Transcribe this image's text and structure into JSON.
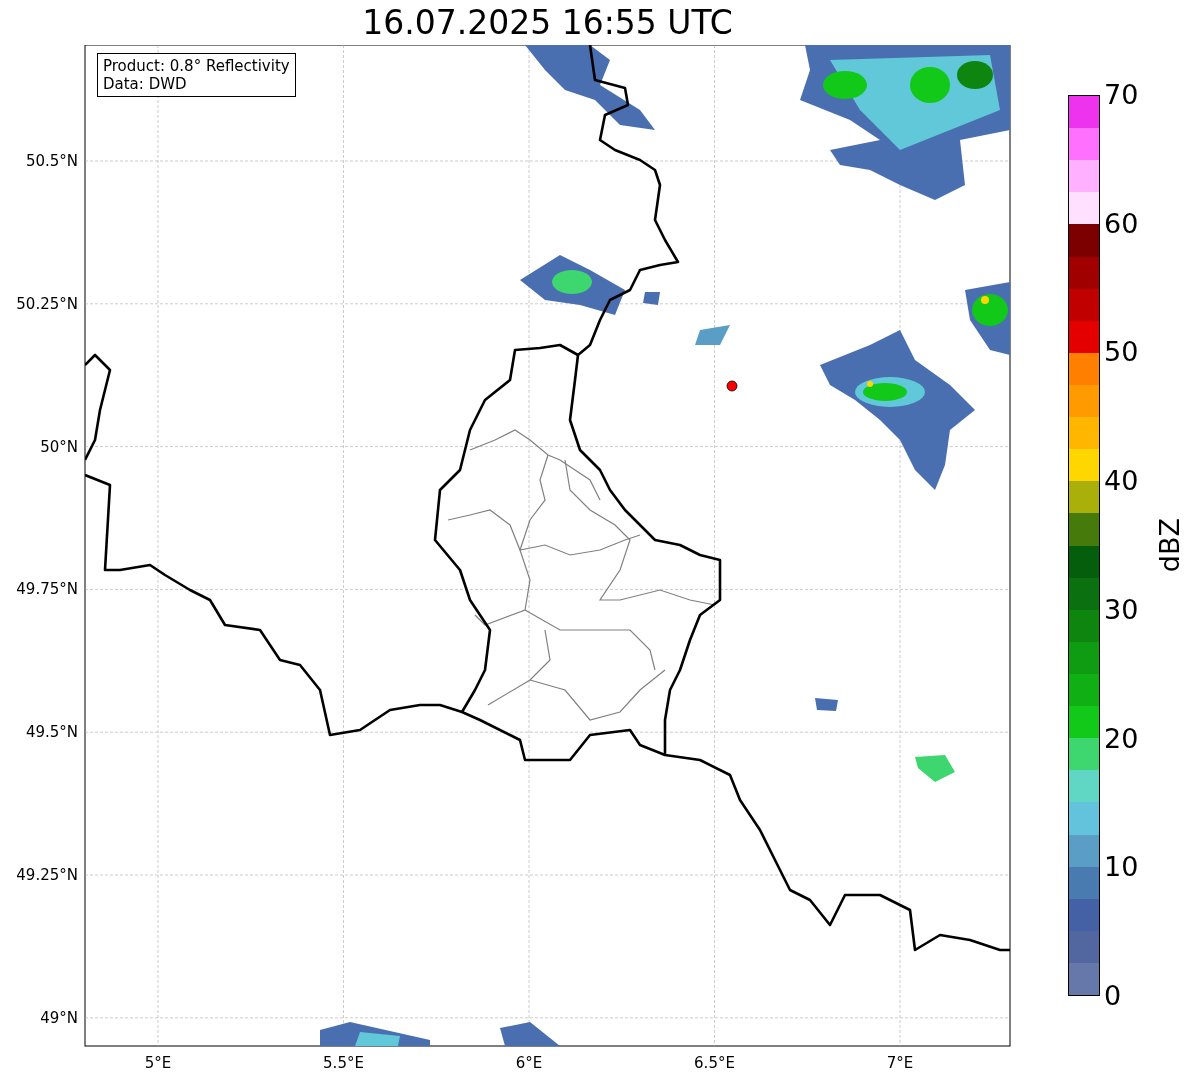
{
  "title": "16.07.2025 16:55 UTC",
  "info_box": {
    "lines": [
      "Product: 0.8° Reflectivity",
      "Data: DWD"
    ]
  },
  "map": {
    "lat_ticks": [
      "50.5°N",
      "50.25°N",
      "50°N",
      "49.75°N",
      "49.5°N",
      "49.25°N",
      "49°N"
    ],
    "lon_ticks": [
      "5°E",
      "5.5°E",
      "6°E",
      "6.5°E",
      "7°E"
    ]
  },
  "colorbar": {
    "label": "dBZ",
    "ticks": [
      "70",
      "60",
      "50",
      "40",
      "30",
      "20",
      "10",
      "0"
    ],
    "bands": [
      {
        "color": "#ee33ee"
      },
      {
        "color": "#ff70ff"
      },
      {
        "color": "#ffb0ff"
      },
      {
        "color": "#ffe0ff"
      },
      {
        "color": "#7d0000"
      },
      {
        "color": "#a00000"
      },
      {
        "color": "#c00000"
      },
      {
        "color": "#e50000"
      },
      {
        "color": "#ff8000"
      },
      {
        "color": "#ff9a00"
      },
      {
        "color": "#ffb600"
      },
      {
        "color": "#ffd700"
      },
      {
        "color": "#aab00a"
      },
      {
        "color": "#467a0a"
      },
      {
        "color": "#055e0b"
      },
      {
        "color": "#0a7010"
      },
      {
        "color": "#0d850f"
      },
      {
        "color": "#0f9b12"
      },
      {
        "color": "#10b014"
      },
      {
        "color": "#12c818"
      },
      {
        "color": "#3dd66f"
      },
      {
        "color": "#60d6c4"
      },
      {
        "color": "#63c3dc"
      },
      {
        "color": "#5a9ec6"
      },
      {
        "color": "#4a7bb0"
      },
      {
        "color": "#4361a4"
      },
      {
        "color": "#5266a0"
      },
      {
        "color": "#6677aa"
      }
    ]
  }
}
